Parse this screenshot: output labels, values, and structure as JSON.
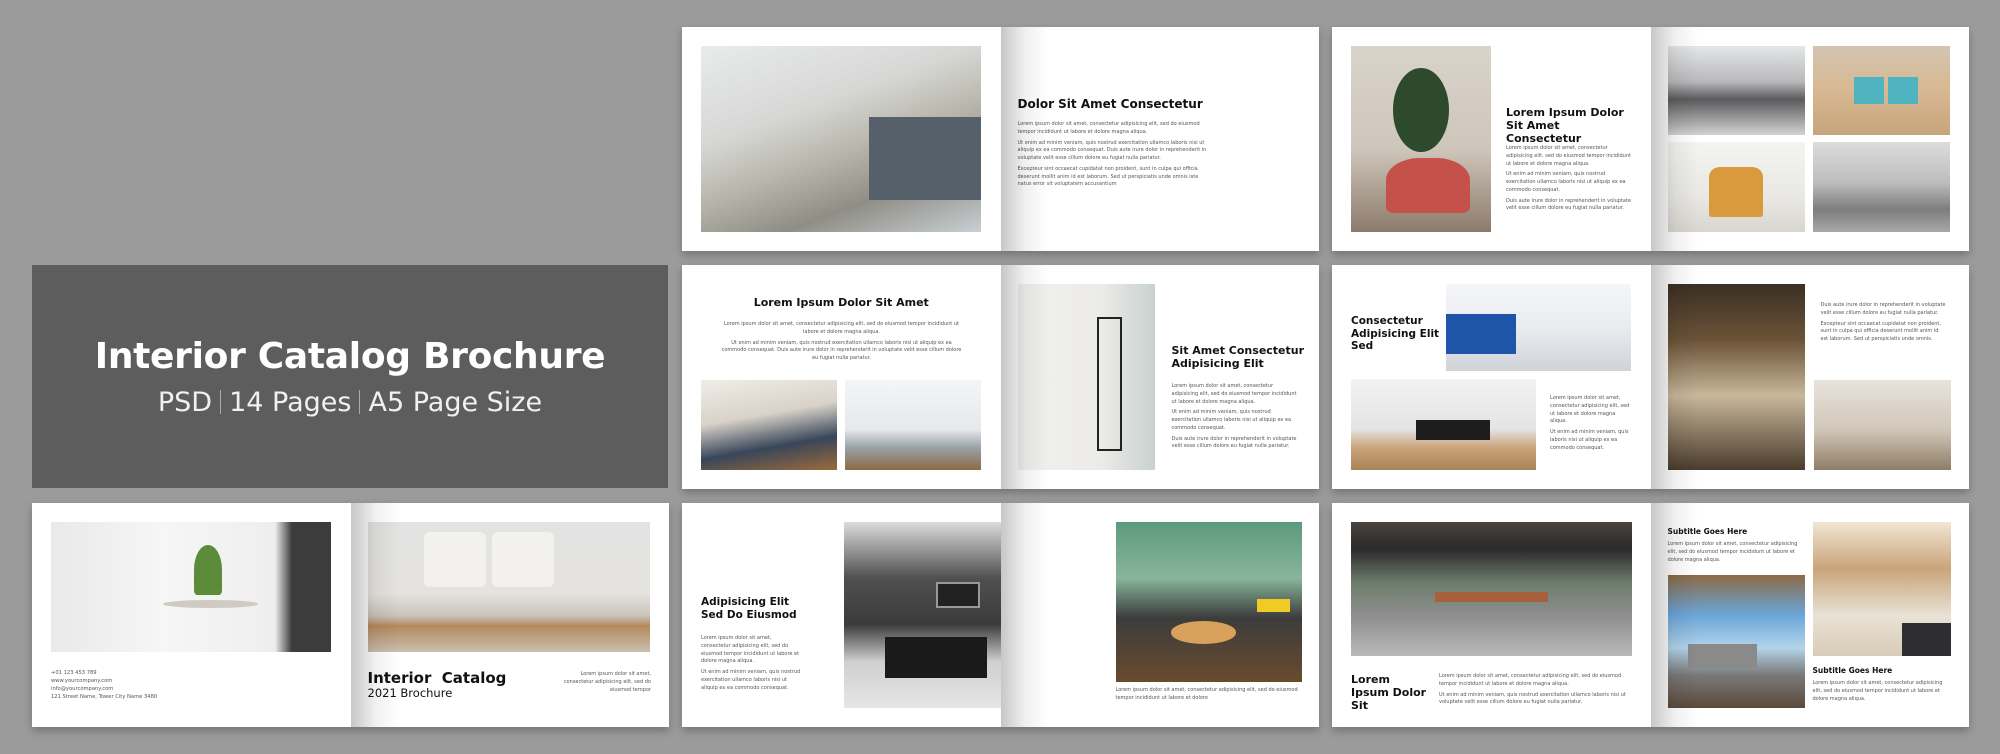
{
  "banner": {
    "title": "Interior Catalog Brochure",
    "format": "PSD",
    "pages": "14 Pages",
    "size": "A5 Page Size"
  },
  "spreads": {
    "s1": {
      "heading": "Dolor Sit Amet Consectetur",
      "p1": "Lorem ipsum dolor sit amet, consectetur adipisicing elit, sed do eiusmod tempor incididunt ut labore et dolore magna aliqua.",
      "p2": "Ut enim ad minim veniam, quis nostrud exercitation ullamco laboris nisi ut aliquip ex ea commodo consequat. Duis aute irure dolor in reprehenderit in voluptate velit esse cillum dolore eu fugiat nulla pariatur.",
      "p3": "Excepteur sint occaecat cupidatat non proident, sunt in culpa qui officia deserunt mollit anim id est laborum. Sed ut perspiciatis unde omnis iste natus error sit voluptatem accusantium"
    },
    "s2": {
      "heading": "Lorem Ipsum Dolor Sit Amet Consectetur",
      "p1": "Lorem ipsum dolor sit amet, consectetur adipisicing elit, sed do eiusmod tempor incididunt ut labore et dolore magna aliqua.",
      "p2": "Ut enim ad minim veniam, quis nostrud exercitation ullamco laboris nisi ut aliquip ex ea commodo consequat.",
      "p3": "Duis aute irure dolor in reprehenderit in voluptate velit esse cillum dolore eu fugiat nulla pariatur."
    },
    "s3": {
      "heading": "Lorem Ipsum Dolor Sit Amet",
      "p1": "Lorem ipsum dolor sit amet, consectetur adipisicing elit, sed do eiusmod tempor incididunt ut labore et dolore magna aliqua.",
      "p2": "Ut enim ad minim veniam, quis nostrud exercitation ullamco laboris nisi ut aliquip ex ea commodo consequat. Duis aute irure dolor in reprehenderit in voluptate velit esse cillum dolore eu fugiat nulla pariatur.",
      "heading2": "Sit Amet Consectetur Adipisicing Elit",
      "q1": "Lorem ipsum dolor sit amet, consectetur adipisicing elit, sed do eiusmod tempor incididunt ut labore et dolore magna aliqua.",
      "q2": "Ut enim ad minim veniam, quis nostrud exercitation ullamco laboris nisi ut aliquip ex ea commodo consequat.",
      "q3": "Duis aute irure dolor in reprehenderit in voluptate velit esse cillum dolore eu fugiat nulla pariatur."
    },
    "s4": {
      "heading": "Consectetur Adipisicing Elit Sed",
      "p1": "Lorem ipsum dolor sit amet, consectetur adipisicing elit, sed ut labore et dolore magna aliqua.",
      "p2": "Ut enim ad minim veniam, quis laboris nisi ut aliquip ex ea commodo consequat.",
      "q1": "Duis aute irure dolor in reprehenderit in voluptate velit esse cillum dolore eu fugiat nulla pariatur.",
      "q2": "Excepteur sint occaecat cupidatat non proident, sunt in culpa qui officia deserunt mollit anim id est laborum. Sed ut perspiciatis unde omnis."
    },
    "cover": {
      "phone": "+01 123 453 789",
      "web": "www.yourcompany.com",
      "email": "info@yourcompany.com",
      "address": "121 Street Name, Tower City Name 3480",
      "title": "Interior  Catalog",
      "subtitle": "2021 Brochure",
      "blurb": "Lorem ipsum dolor sit amet, consectetur adipisicing elit, sed do eiusmod tempor"
    },
    "s5": {
      "heading": "Adipisicing Elit Sed Do Eiusmod",
      "p1": "Lorem ipsum dolor sit amet, consectetur adipisicing elit, sed do eiusmod tempor incididunt ut labore et dolore magna aliqua.",
      "p2": "Ut enim ad minim veniam, quis nostrud exercitation ullamco laboris nisi ut aliquip ex ea commodo consequat.",
      "caption": "Lorem ipsum dolor sit amet, consectetur adipisicing elit, sed do eiusmod tempor incididunt ut labore et dolore"
    },
    "s6": {
      "heading": "Lorem Ipsum Dolor Sit",
      "p1": "Lorem ipsum dolor sit amet, consectetur adipisicing elit, sed do eiusmod tempor incididunt ut labore et dolore magna aliqua.",
      "p2": "Ut enim ad minim veniam, quis nostrud exercitation ullamco laboris nisi ut voluptate velit esse cillum dolore eu fugiat nulla pariatur.",
      "sub1": "Subtitle Goes Here",
      "sub1_text": "Lorem ipsum dolor sit amet, consectetur adipisicing elit, sed do eiusmod tempor incididunt ut labore et dolore magna aliqua.",
      "sub2": "Subtitle Goes Here",
      "sub2_text": "Lorem ipsum dolor sit amet, consectetur adipisicing elit, sed do eiusmod tempor incididunt ut labore et dolore magna aliqua."
    }
  }
}
